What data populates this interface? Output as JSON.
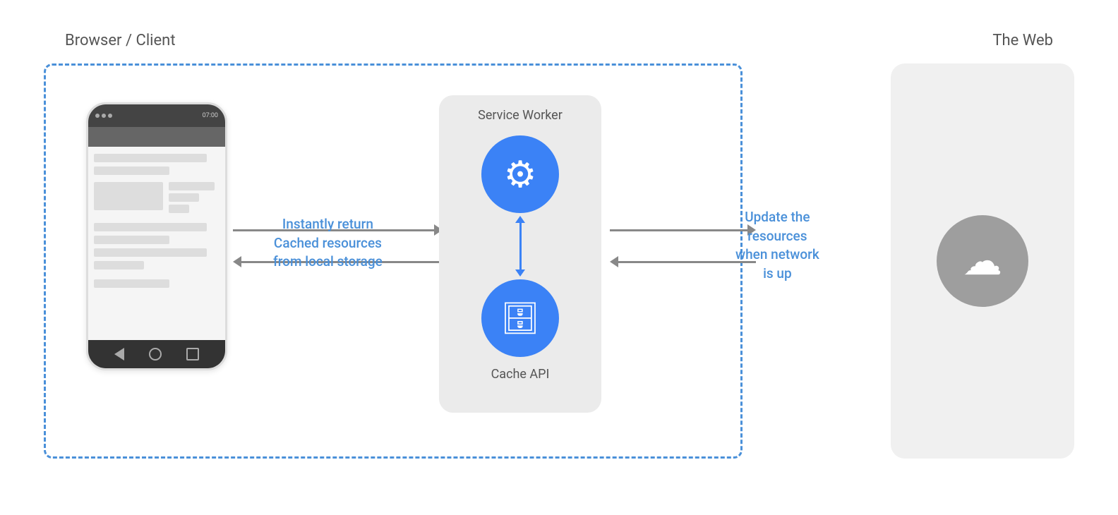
{
  "labels": {
    "browser_client": "Browser / Client",
    "the_web": "The Web",
    "service_worker": "Service Worker",
    "cache_api": "Cache API",
    "instantly_return": "Instantly return",
    "cached_resources": "Cached resources",
    "from_local_storage": "from local storage",
    "update_the": "Update the",
    "resources": "resources",
    "when_network": "when network",
    "is_up": "is up"
  },
  "colors": {
    "blue_accent": "#4A90D9",
    "arrow_gray": "#888888",
    "sw_box_bg": "#EBEBEB",
    "web_box_bg": "#F0F0F0",
    "gear_db_blue": "#3B82F6",
    "cloud_gray": "#9E9E9E"
  }
}
